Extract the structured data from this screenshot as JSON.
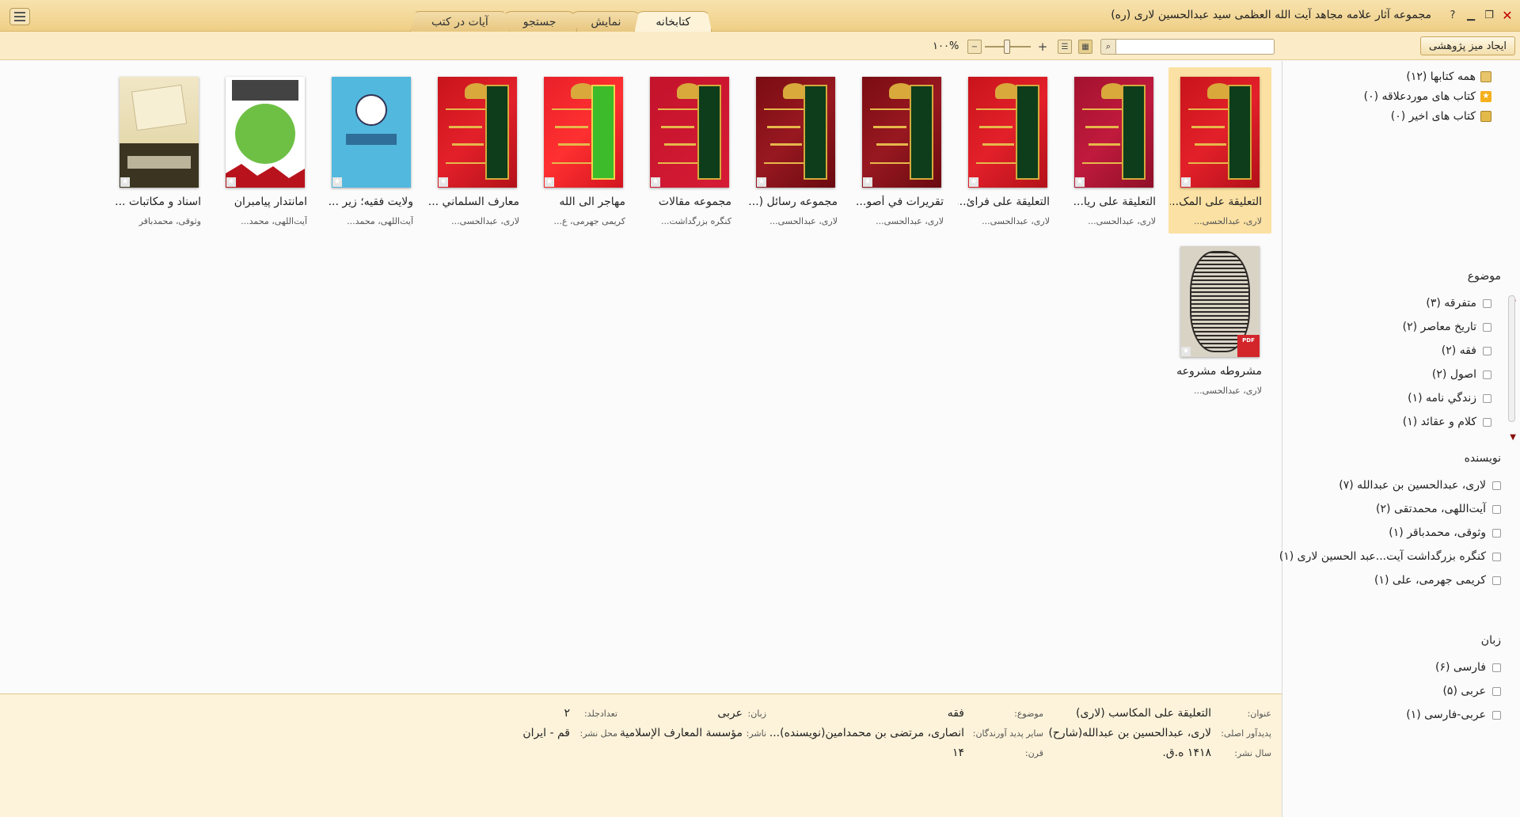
{
  "window": {
    "title": "مجموعه آثار علامه مجاهد آیت الله العظمی سید عبدالحسین لاری (ره)",
    "controls": {
      "close": "✕",
      "restore": "❐",
      "minimize": "▁",
      "help": "?"
    }
  },
  "tabs": [
    {
      "label": "کتابخانه",
      "active": true
    },
    {
      "label": "نمایش",
      "active": false
    },
    {
      "label": "جستجو",
      "active": false
    },
    {
      "label": "آیات در کتب",
      "active": false
    }
  ],
  "toolbar": {
    "research_button": "ایجاد میز پژوهشی",
    "search_placeholder": "",
    "zoom_value": "۱۰۰%",
    "zoom_level_percent": 100,
    "view_mode": "grid"
  },
  "books": [
    {
      "title": "التعلیقة علی المک...",
      "author": "لاری، عبدالحسی...",
      "cover": "red",
      "selected": true
    },
    {
      "title": "التعلیقة علی ریا...",
      "author": "لاری، عبدالحسی...",
      "cover": "crimson"
    },
    {
      "title": "التعلیقة علی فرائ...",
      "author": "لاری، عبدالحسی...",
      "cover": "red"
    },
    {
      "title": "تقریرات في أصو...",
      "author": "لاری، عبدالحسی...",
      "cover": "dark"
    },
    {
      "title": "مجموعه رسائل (...",
      "author": "لاری، عبدالحسی...",
      "cover": "dark"
    },
    {
      "title": "مجموعه مقالات",
      "author": "کنگره بزرگداشت...",
      "cover": "pink"
    },
    {
      "title": "مهاجر الی الله",
      "author": "کریمی جهرمی، ع...",
      "cover": "bright"
    },
    {
      "title": "معارف السلماني ...",
      "author": "لاری، عبدالحسی...",
      "cover": "red"
    },
    {
      "title": "ولایت فقیه؛ زیر ...",
      "author": "آیت‌اللهی، محمد...",
      "cover": "blue"
    },
    {
      "title": "امانتدار پیامبران",
      "author": "آیت‌اللهی، محمد...",
      "cover": "green"
    },
    {
      "title": "اسناد و مکاتبات ...",
      "author": "وثوقی، محمدباقر",
      "cover": "olive"
    },
    {
      "title": "مشروطه مشروعه",
      "author": "لاری، عبدالحسی...",
      "cover": "manuscript",
      "pdf": true
    }
  ],
  "pdf_badge": "PDF",
  "sidebar": {
    "nav": [
      {
        "label": "همه کتابها (۱۲)",
        "icon": "books-icon"
      },
      {
        "label": "کتاب های موردعلاقه (۰)",
        "icon": "star-icon"
      },
      {
        "label": "کتاب های اخیر (۰)",
        "icon": "recent-icon"
      }
    ],
    "subject": {
      "heading": "موضوع",
      "items": [
        "متفرقه (۳)",
        "تاریخ معاصر (۲)",
        "فقه (۲)",
        "اصول (۲)",
        "زندگي نامه (۱)",
        "کلام و عقائد (۱)"
      ]
    },
    "author": {
      "heading": "نویسنده",
      "items": [
        "لاری، عبدالحسین بن عبدالله (۷)",
        "آیت‌اللهی، محمدتقی (۲)",
        "وثوقی، محمدباقر (۱)",
        "کنگره بزرگداشت آیت...عبد الحسين لاری (۱)",
        "کریمی جهرمی، علی (۱)"
      ]
    },
    "language": {
      "heading": "زبان",
      "items": [
        "فارسی (۶)",
        "عربی (۵)",
        "عربی-فارسی (۱)"
      ]
    }
  },
  "details": {
    "title_label": "عنوان:",
    "title_value": "التعلیقة علی المکاسب (لاری)",
    "creator_label": "پدیدآور اصلی:",
    "creator_value": "لاری، عبدالحسین بن عبدالله(شارح)",
    "year_label": "سال نشر:",
    "year_value": "۱۴۱۸ ه.ق.",
    "subject_label": "موضوع:",
    "subject_value": "فقه",
    "others_label": "سایر پدید آورندگان:",
    "others_value": "انصاری، مرتضی بن محمدامین(نویسنده)...",
    "century_label": "قرن:",
    "century_value": "۱۴",
    "language_label": "زبان:",
    "language_value": "عربی",
    "publisher_label": "ناشر:",
    "publisher_value": "مؤسسة المعارف الإسلامية",
    "volumes_label": "تعدادجلد:",
    "volumes_value": "۲",
    "place_label": "محل نشر:",
    "place_value": "قم - ایران"
  }
}
